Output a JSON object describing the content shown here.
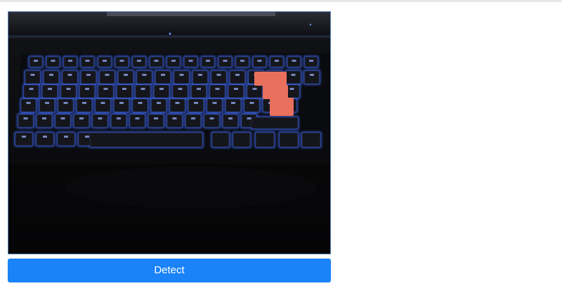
{
  "camera_view": {
    "description_icon": "keyboard-camera-feed",
    "highlight_color": "#e8705c",
    "backlight_color": "#3f6cff"
  },
  "actions": {
    "detect_label": "Detect"
  },
  "colors": {
    "button_bg": "#1a83f7",
    "button_text": "#ffffff",
    "frame_border": "#5a86c0"
  }
}
